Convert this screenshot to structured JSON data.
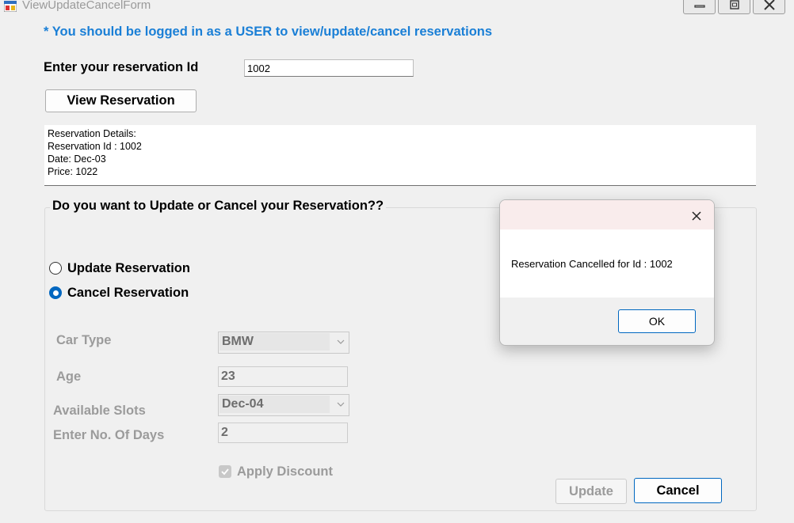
{
  "window": {
    "title": "ViewUpdateCancelForm",
    "controls": [
      "minimize-icon",
      "maximize-icon",
      "close-icon"
    ]
  },
  "form": {
    "notice": "* You should be logged in as a USER to view/update/cancel reservations",
    "reservation_id_label": "Enter your reservation Id",
    "reservation_id_value": "1002",
    "view_button": "View Reservation",
    "details": [
      "Reservation Details:",
      "Reservation Id : 1002",
      "Date: Dec-03",
      "Price: 1022"
    ],
    "group_title": "Do you want to Update or Cancel your Reservation??",
    "radio_update": "Update Reservation",
    "radio_cancel": "Cancel Reservation",
    "selected_option": "cancel",
    "car_type_label": "Car Type",
    "car_type_value": "BMW",
    "age_label": "Age",
    "age_value": "23",
    "slots_label": "Available Slots",
    "slots_value": "Dec-04",
    "days_label": "Enter No. Of Days",
    "days_value": "2",
    "discount_label": "Apply Discount",
    "discount_checked": true,
    "update_button": "Update",
    "cancel_button": "Cancel"
  },
  "dialog": {
    "message": "Reservation Cancelled for Id : 1002",
    "ok_button": "OK"
  },
  "colors": {
    "accent": "#0067c0",
    "notice": "#1a7fd6",
    "disabled_text": "#9b9b9b"
  }
}
